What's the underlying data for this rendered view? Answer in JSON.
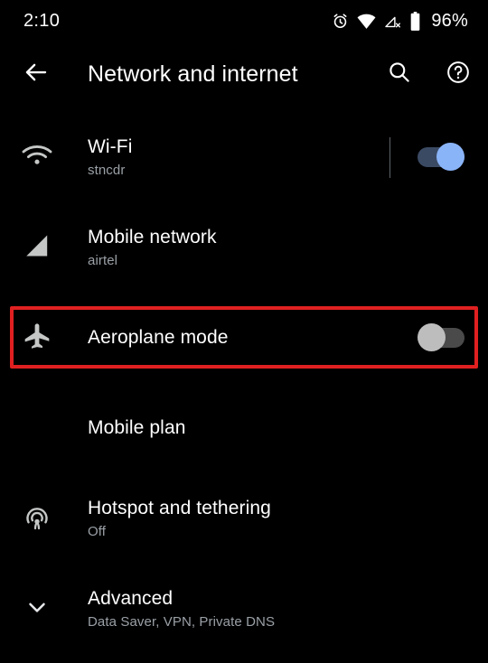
{
  "status_bar": {
    "time": "2:10",
    "battery_percent": "96%",
    "icons": [
      "alarm-icon",
      "wifi-icon",
      "mobile-signal-off-icon",
      "battery-icon"
    ]
  },
  "toolbar": {
    "back_label": "back-arrow",
    "title": "Network and internet",
    "search_label": "Search",
    "help_label": "Help"
  },
  "colors": {
    "background": "#000000",
    "title_text": "#ffffff",
    "subtitle_text": "#9aa0a6",
    "icon": "#c4c7c5",
    "switch_on_thumb": "#8ab4f8",
    "switch_on_track": "#3b4a63",
    "switch_off_thumb": "#bdbdbd",
    "switch_off_track": "#4a4a4a",
    "highlight_border": "#e02020"
  },
  "list": {
    "items": [
      {
        "id": "wifi",
        "icon": "wifi-icon",
        "title": "Wi-Fi",
        "subtitle": "stncdr",
        "has_switch": true,
        "switch_state": "on",
        "has_switch_divider": true
      },
      {
        "id": "mobile-network",
        "icon": "signal-cellular-icon",
        "title": "Mobile network",
        "subtitle": "airtel",
        "has_switch": false
      },
      {
        "id": "aeroplane-mode",
        "icon": "aeroplane-icon",
        "title": "Aeroplane mode",
        "subtitle": "",
        "has_switch": true,
        "switch_state": "off",
        "highlighted": true
      },
      {
        "id": "mobile-plan",
        "icon": "",
        "title": "Mobile plan",
        "subtitle": "",
        "has_switch": false
      },
      {
        "id": "hotspot-and-tethering",
        "icon": "hotspot-icon",
        "title": "Hotspot and tethering",
        "subtitle": "Off",
        "has_switch": false
      },
      {
        "id": "advanced",
        "icon": "chevron-down-icon",
        "title": "Advanced",
        "subtitle": "Data Saver, VPN, Private DNS",
        "has_switch": false
      }
    ]
  }
}
